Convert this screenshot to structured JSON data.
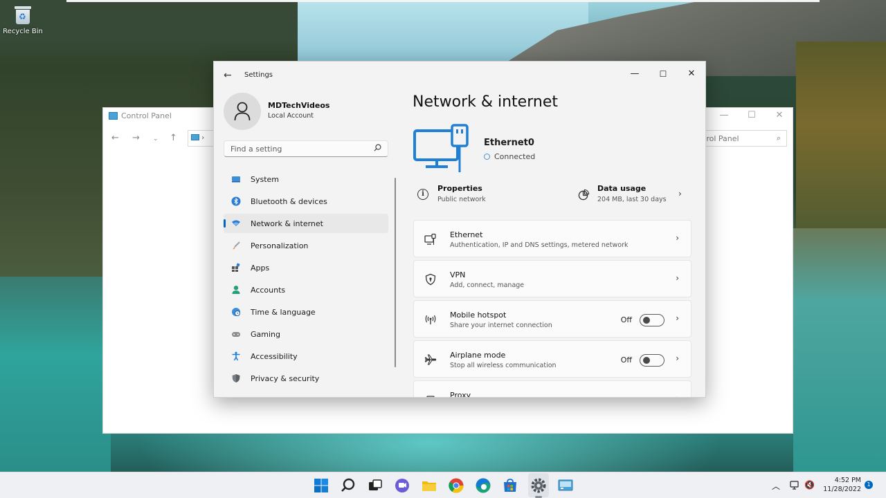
{
  "desktop": {
    "recycle_bin_label": "Recycle Bin"
  },
  "control_panel": {
    "title": "Control Panel",
    "search_text": "trol Panel",
    "address_text": "›"
  },
  "settings": {
    "window_title": "Settings",
    "profile": {
      "name": "MDTechVideos",
      "account_type": "Local Account"
    },
    "search_placeholder": "Find a setting",
    "nav": [
      {
        "label": "System",
        "icon": "monitor-icon"
      },
      {
        "label": "Bluetooth & devices",
        "icon": "bluetooth-icon"
      },
      {
        "label": "Network & internet",
        "icon": "wifi-icon",
        "active": true
      },
      {
        "label": "Personalization",
        "icon": "brush-icon"
      },
      {
        "label": "Apps",
        "icon": "apps-icon"
      },
      {
        "label": "Accounts",
        "icon": "person-icon"
      },
      {
        "label": "Time & language",
        "icon": "globe-clock-icon"
      },
      {
        "label": "Gaming",
        "icon": "gamepad-icon"
      },
      {
        "label": "Accessibility",
        "icon": "accessibility-icon"
      },
      {
        "label": "Privacy & security",
        "icon": "shield-icon"
      }
    ],
    "page_title": "Network & internet",
    "connection": {
      "name": "Ethernet0",
      "status": "Connected"
    },
    "properties": {
      "title": "Properties",
      "subtitle": "Public network"
    },
    "data_usage": {
      "title": "Data usage",
      "subtitle": "204 MB, last 30 days"
    },
    "cards": [
      {
        "title": "Ethernet",
        "subtitle": "Authentication, IP and DNS settings, metered network"
      },
      {
        "title": "VPN",
        "subtitle": "Add, connect, manage"
      },
      {
        "title": "Mobile hotspot",
        "subtitle": "Share your internet connection",
        "state": "Off"
      },
      {
        "title": "Airplane mode",
        "subtitle": "Stop all wireless communication",
        "state": "Off"
      },
      {
        "title": "Proxy",
        "subtitle": ""
      }
    ]
  },
  "taskbar": {
    "time": "4:52 PM",
    "date": "11/28/2022",
    "notification_count": "1"
  },
  "colors": {
    "accent": "#0067c0",
    "ethernet_icon": "#1f7fd4"
  }
}
